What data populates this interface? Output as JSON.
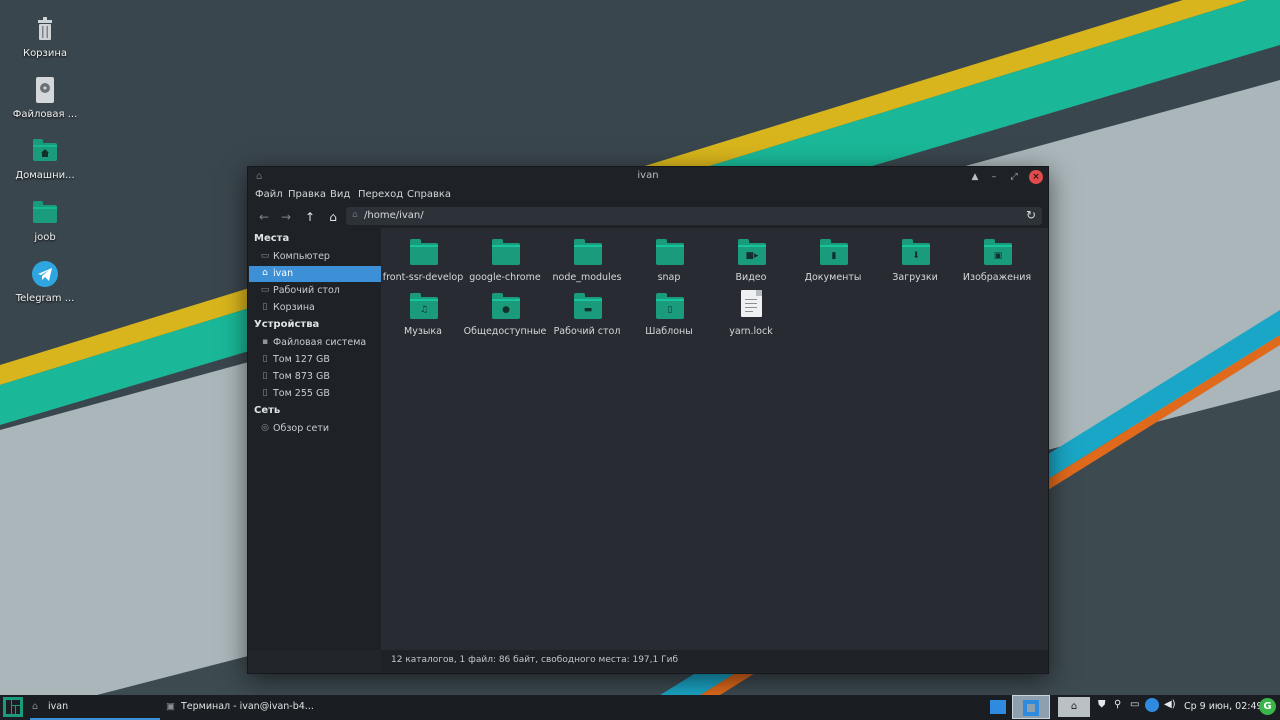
{
  "desktop": {
    "icons": [
      {
        "label": "Корзина",
        "icon": "trash-icon"
      },
      {
        "label": "Файловая ...",
        "icon": "drive-icon"
      },
      {
        "label": "Домашни...",
        "icon": "home-folder-icon"
      },
      {
        "label": "joob",
        "icon": "folder-icon"
      },
      {
        "label": "Telegram ...",
        "icon": "telegram-icon"
      }
    ]
  },
  "window": {
    "title": "ivan",
    "menu": [
      "Файл",
      "Правка",
      "Вид",
      "Переход",
      "Справка"
    ],
    "path": "/home/ivan/",
    "sidebar": {
      "places_header": "Места",
      "places": [
        {
          "label": "Компьютер",
          "icon": "computer-icon"
        },
        {
          "label": "ivan",
          "icon": "home-icon",
          "selected": true
        },
        {
          "label": "Рабочий стол",
          "icon": "desktop-icon"
        },
        {
          "label": "Корзина",
          "icon": "trash-icon"
        }
      ],
      "devices_header": "Устройства",
      "devices": [
        {
          "label": "Файловая система",
          "icon": "drive-icon"
        },
        {
          "label": "Том 127 GB",
          "icon": "volume-icon"
        },
        {
          "label": "Том 873 GB",
          "icon": "volume-icon"
        },
        {
          "label": "Том 255 GB",
          "icon": "volume-icon"
        }
      ],
      "network_header": "Сеть",
      "network": [
        {
          "label": "Обзор сети",
          "icon": "network-icon"
        }
      ]
    },
    "files": [
      {
        "name": "front-ssr-develop",
        "type": "folder"
      },
      {
        "name": "google-chrome",
        "type": "folder"
      },
      {
        "name": "node_modules",
        "type": "folder"
      },
      {
        "name": "snap",
        "type": "folder"
      },
      {
        "name": "Видео",
        "type": "folder-video"
      },
      {
        "name": "Документы",
        "type": "folder-documents"
      },
      {
        "name": "Загрузки",
        "type": "folder-downloads"
      },
      {
        "name": "Изображения",
        "type": "folder-pictures"
      },
      {
        "name": "Музыка",
        "type": "folder-music"
      },
      {
        "name": "Общедоступные",
        "type": "folder-public"
      },
      {
        "name": "Рабочий стол",
        "type": "folder-desktop"
      },
      {
        "name": "Шаблоны",
        "type": "folder-templates"
      },
      {
        "name": "yarn.lock",
        "type": "text-file"
      }
    ],
    "status": "12 каталогов, 1 файл: 86 байт, свободного места: 197,1 Гиб"
  },
  "taskbar": {
    "tasks": [
      {
        "label": "ivan",
        "active": true
      },
      {
        "label": "Терминал - ivan@ivan-b4...",
        "active": false
      }
    ],
    "clock": "Ср 9 июн, 02:49"
  },
  "colors": {
    "accent": "#1a9c7c",
    "selection": "#3d8fd6",
    "close": "#e14b4b"
  }
}
